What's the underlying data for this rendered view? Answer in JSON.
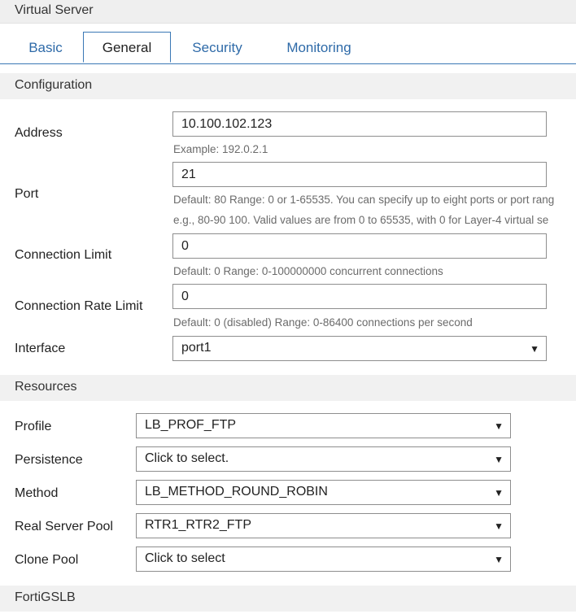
{
  "window": {
    "title": "Virtual Server"
  },
  "tabs": [
    {
      "label": "Basic"
    },
    {
      "label": "General"
    },
    {
      "label": "Security"
    },
    {
      "label": "Monitoring"
    }
  ],
  "configuration": {
    "section_title": "Configuration",
    "address": {
      "label": "Address",
      "value": "10.100.102.123",
      "hint": "Example: 192.0.2.1"
    },
    "port": {
      "label": "Port",
      "value": "21",
      "hint_line1": "Default: 80 Range: 0 or 1-65535. You can specify up to eight ports or port rang",
      "hint_line2": "e.g., 80-90 100. Valid values are from 0 to 65535, with 0 for Layer-4 virtual se"
    },
    "connection_limit": {
      "label": "Connection Limit",
      "value": "0",
      "hint": "Default: 0 Range: 0-100000000 concurrent connections"
    },
    "connection_rate_limit": {
      "label": "Connection Rate Limit",
      "value": "0",
      "hint": "Default: 0 (disabled) Range: 0-86400 connections per second"
    },
    "interface": {
      "label": "Interface",
      "value": "port1"
    }
  },
  "resources": {
    "section_title": "Resources",
    "profile": {
      "label": "Profile",
      "value": "LB_PROF_FTP"
    },
    "persistence": {
      "label": "Persistence",
      "value": "Click to select."
    },
    "method": {
      "label": "Method",
      "value": "LB_METHOD_ROUND_ROBIN"
    },
    "real_server_pool": {
      "label": "Real Server Pool",
      "value": "RTR1_RTR2_FTP"
    },
    "clone_pool": {
      "label": "Clone Pool",
      "value": "Click to select"
    }
  },
  "fortigslb": {
    "section_title": "FortiGSLB"
  },
  "icons": {
    "dropdown": "caret-down-icon"
  },
  "colors": {
    "tab_link": "#2e6aa8",
    "tab_border": "#3a78b5",
    "section_bg": "#f1f1f1"
  }
}
